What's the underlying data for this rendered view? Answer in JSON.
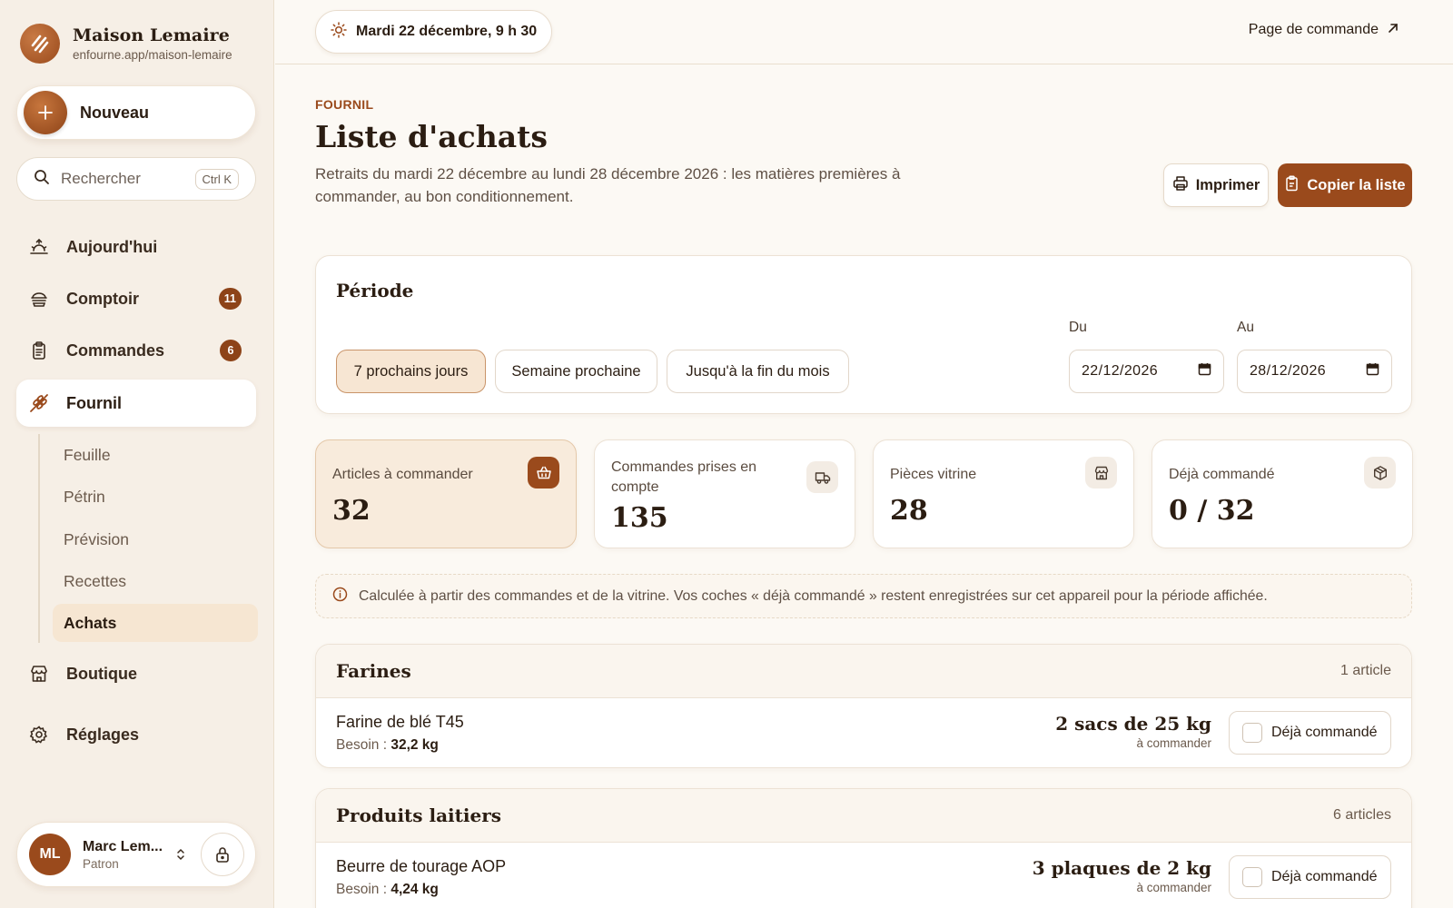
{
  "brand": {
    "name": "Maison Lemaire",
    "url": "enfourne.app/maison-lemaire"
  },
  "new_button": {
    "label": "Nouveau"
  },
  "search": {
    "placeholder": "Rechercher",
    "shortcut": "Ctrl K"
  },
  "nav": {
    "today": "Aujourd'hui",
    "counter": {
      "label": "Comptoir",
      "badge": "11"
    },
    "orders": {
      "label": "Commandes",
      "badge": "6"
    },
    "bakehouse": "Fournil",
    "sub": {
      "sheet": "Feuille",
      "kneader": "Pétrin",
      "forecast": "Prévision",
      "recipes": "Recettes",
      "purchases": "Achats"
    },
    "shop": "Boutique",
    "settings": "Réglages"
  },
  "user": {
    "initials": "ML",
    "name": "Marc Lem...",
    "role": "Patron"
  },
  "topbar": {
    "date": "Mardi 22 décembre, 9 h 30",
    "order_page": "Page de commande"
  },
  "header": {
    "eyebrow": "FOURNIL",
    "title": "Liste d'achats",
    "subtitle": "Retraits du mardi 22 décembre au lundi 28 décembre 2026 : les matières premières à commander, au bon conditionnement.",
    "print": "Imprimer",
    "copy": "Copier la liste"
  },
  "period": {
    "title": "Période",
    "presets": [
      "7 prochains jours",
      "Semaine prochaine",
      "Jusqu'à la fin du mois"
    ],
    "active_preset": "7 prochains jours",
    "from_label": "Du",
    "from_value": "22/12/2026",
    "to_label": "Au",
    "to_value": "28/12/2026"
  },
  "stats": [
    {
      "label": "Articles à commander",
      "value": "32",
      "icon": "basket-icon"
    },
    {
      "label": "Commandes prises en compte",
      "value": "135",
      "icon": "truck-icon"
    },
    {
      "label": "Pièces vitrine",
      "value": "28",
      "icon": "store-icon"
    },
    {
      "label": "Déjà commandé",
      "value": "0 / 32",
      "icon": "package-check-icon"
    }
  ],
  "note": "Calculée à partir des commandes et de la vitrine. Vos coches « déjà commandé » restent enregistrées sur cet appareil pour la période affichée.",
  "sections": [
    {
      "name": "Farines",
      "count": "1 article",
      "items": [
        {
          "name": "Farine de blé T45",
          "need_label": "Besoin :",
          "need": "32,2 kg",
          "qty": "2 sacs de 25 kg",
          "qty_sub": "à commander",
          "check_label": "Déjà commandé",
          "checked": false
        }
      ]
    },
    {
      "name": "Produits laitiers",
      "count": "6 articles",
      "items": [
        {
          "name": "Beurre de tourage AOP",
          "need_label": "Besoin :",
          "need": "4,24 kg",
          "qty": "3 plaques de 2 kg",
          "qty_sub": "à commander",
          "check_label": "Déjà commandé",
          "checked": false
        }
      ]
    }
  ],
  "colors": {
    "accent": "#9a4a1c",
    "background": "#fcf9f4",
    "sidebar": "#f6efe6",
    "highlight": "#f8ebdc"
  }
}
